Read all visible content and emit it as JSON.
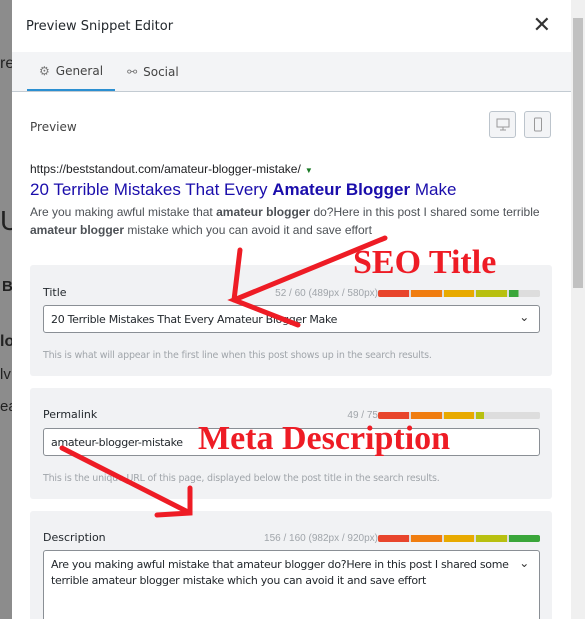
{
  "background": {
    "fragments": [
      "re",
      "U",
      "B",
      "lo",
      "lv",
      "ea"
    ]
  },
  "modal": {
    "title": "Preview Snippet Editor",
    "close_icon": "x-icon"
  },
  "tabs": [
    {
      "label": "General",
      "icon": "gear-icon",
      "active": true
    },
    {
      "label": "Social",
      "icon": "share-nodes-icon",
      "active": false
    }
  ],
  "preview": {
    "label": "Preview",
    "devices": [
      "desktop-icon",
      "mobile-icon"
    ],
    "url_prefix": "https://beststandout.com/",
    "url_slug": "amateur-blogger-mistake/",
    "title_parts": [
      "20 Terrible Mistakes That Every ",
      "Amateur Blogger",
      " Make"
    ],
    "desc_parts": [
      "Are you making awful mistake that ",
      "amateur blogger",
      " do?Here in this post I shared some terrible ",
      "amateur blogger",
      " mistake which you can avoid it and save effort"
    ]
  },
  "fields": {
    "title": {
      "label": "Title",
      "count": "52 / 60 (489px / 580px)",
      "progress": 0.86,
      "value": "20 Terrible Mistakes That Every Amateur Blogger Make",
      "help": "This is what will appear in the first line when this post shows up in the search results."
    },
    "permalink": {
      "label": "Permalink",
      "count": "49 / 75",
      "progress": 0.65,
      "value": "amateur-blogger-mistake",
      "help": "This is the unique URL of this page, displayed below the post title in the search results."
    },
    "description": {
      "label": "Description",
      "count": "156 / 160 (982px / 920px)",
      "progress": 1.0,
      "value": "Are you making awful mistake that amateur blogger do?Here in this post I shared some terrible amateur blogger mistake which you can avoid it and save effort"
    }
  },
  "annotations": {
    "seo_title": "SEO Title",
    "meta_description": "Meta Description",
    "color": "#ee1c25"
  },
  "bar_colors": [
    "#e8452c",
    "#f07d10",
    "#e8aa00",
    "#b8c010",
    "#3aa63a"
  ]
}
